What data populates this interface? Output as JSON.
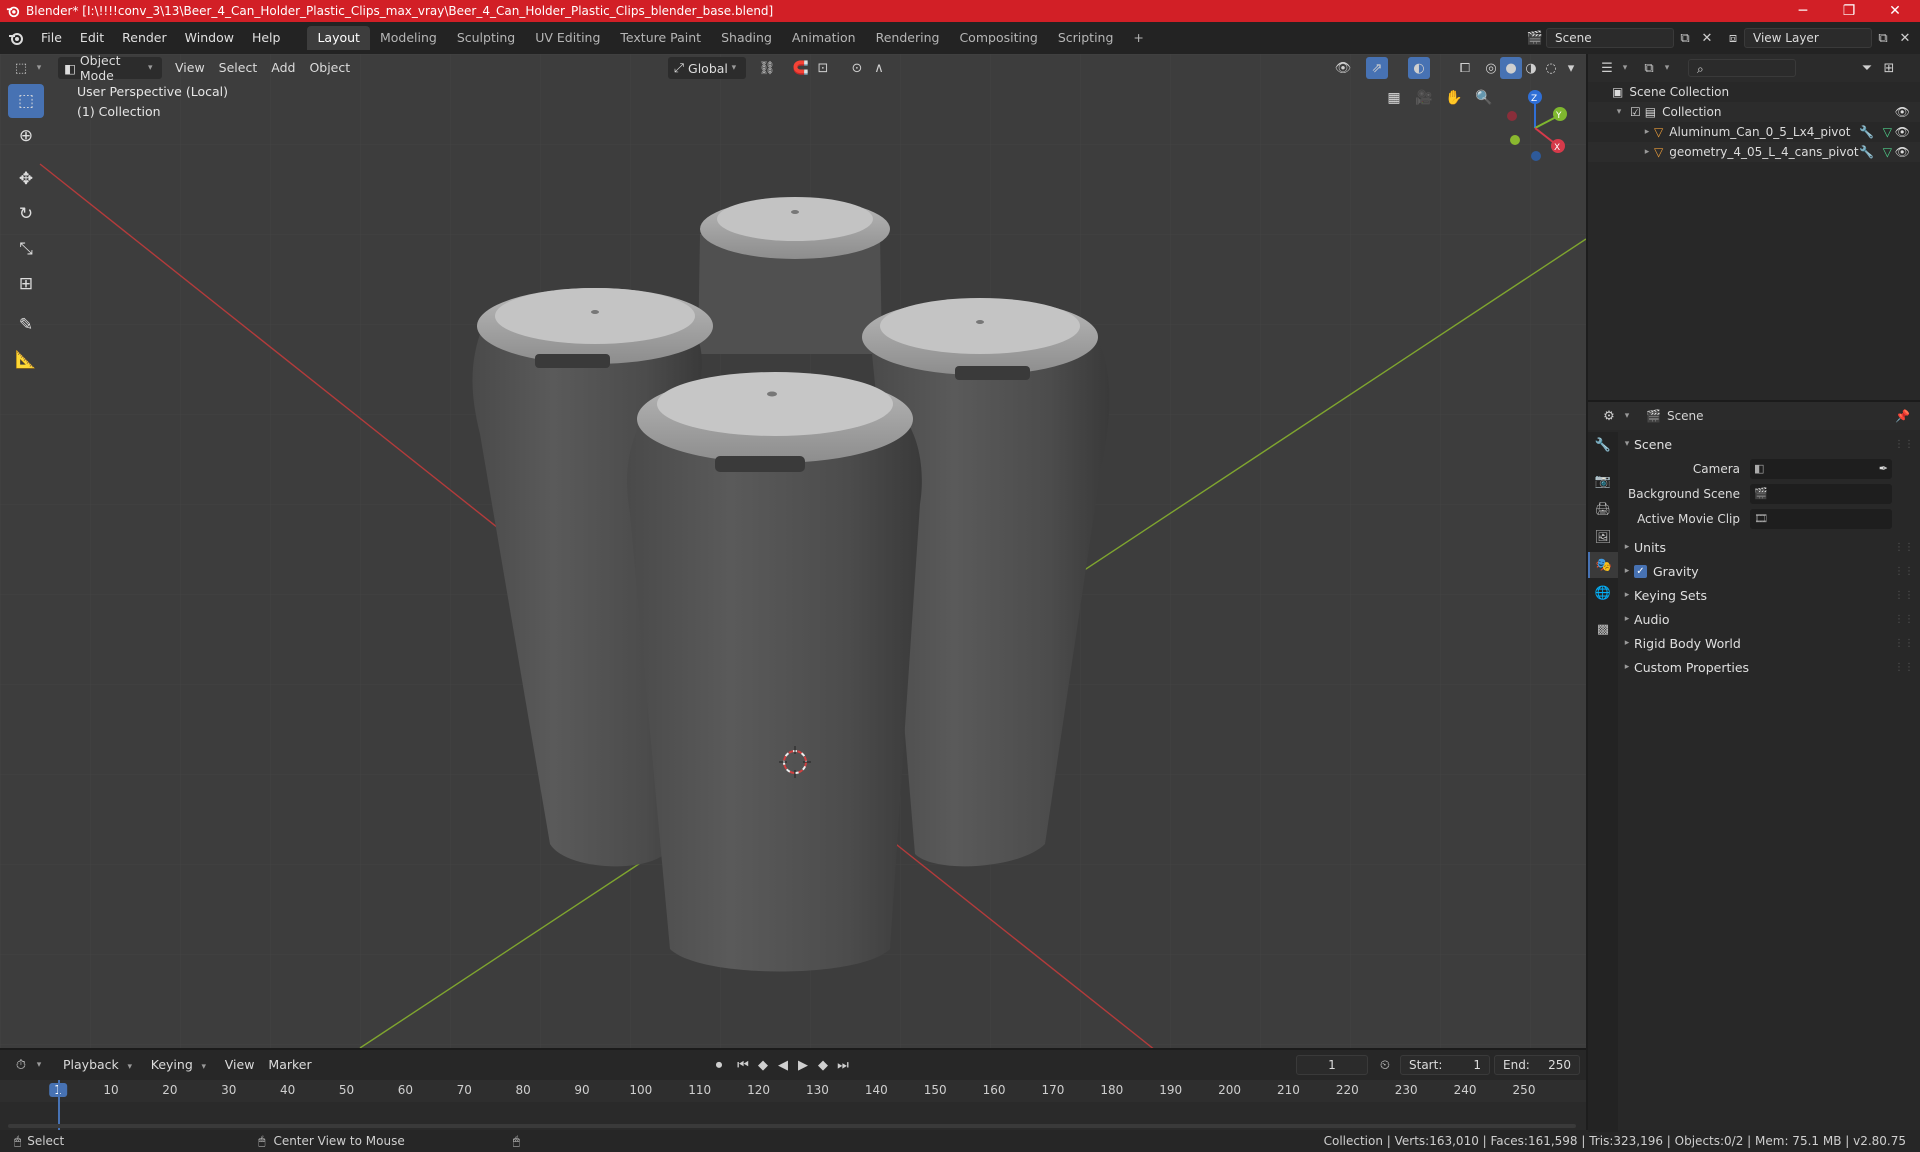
{
  "title_bar": {
    "title": "Blender* [I:\\!!!!conv_3\\13\\Beer_4_Can_Holder_Plastic_Clips_max_vray\\Beer_4_Can_Holder_Plastic_Clips_blender_base.blend]",
    "minimize": "─",
    "maximize": "❐",
    "close": "✕"
  },
  "menu": {
    "items": [
      "File",
      "Edit",
      "Render",
      "Window",
      "Help"
    ],
    "workspaces": [
      "Layout",
      "Modeling",
      "Sculpting",
      "UV Editing",
      "Texture Paint",
      "Shading",
      "Animation",
      "Rendering",
      "Compositing",
      "Scripting"
    ],
    "add_workspace": "+",
    "scene_name": "Scene",
    "view_layer": "View Layer"
  },
  "viewport": {
    "header": {
      "mode": "Object Mode",
      "menus": [
        "View",
        "Select",
        "Add",
        "Object"
      ],
      "orientation": "Global"
    },
    "overlay_text": {
      "perspective": "User Perspective (Local)",
      "collection": "(1) Collection"
    },
    "gizmo": {
      "z": "Z",
      "y": "Y",
      "x": "X"
    }
  },
  "outliner": {
    "scene_collection": "Scene Collection",
    "collection": "Collection",
    "objects": [
      "Aluminum_Can_0_5_Lx4_pivot",
      "geometry_4_05_L_4_cans_pivot"
    ]
  },
  "properties": {
    "context": "Scene",
    "panel_title": "Scene",
    "fields": [
      {
        "label": "Camera"
      },
      {
        "label": "Background Scene"
      },
      {
        "label": "Active Movie Clip"
      }
    ],
    "subpanels": [
      "Units",
      "Gravity",
      "Keying Sets",
      "Audio",
      "Rigid Body World",
      "Custom Properties"
    ],
    "gravity_checked": true
  },
  "timeline": {
    "menus": [
      "Playback",
      "Keying",
      "View",
      "Marker"
    ],
    "current_frame": "1",
    "start_label": "Start:",
    "start": "1",
    "end_label": "End:",
    "end": "250",
    "ticks": [
      "1",
      "10",
      "20",
      "30",
      "40",
      "50",
      "60",
      "70",
      "80",
      "90",
      "100",
      "110",
      "120",
      "130",
      "140",
      "150",
      "160",
      "170",
      "180",
      "190",
      "200",
      "210",
      "220",
      "230",
      "240",
      "250"
    ]
  },
  "status_bar": {
    "select": "Select",
    "center_view": "Center View to Mouse",
    "stats": "Collection | Verts:163,010 | Faces:161,598 | Tris:323,196 | Objects:0/2 | Mem: 75.1 MB | v2.80.75"
  },
  "colors": {
    "title_bar": "#d21f26",
    "accent": "#4772b3",
    "viewport_bg": "#3d3d3d",
    "x_axis": "#b33b3b",
    "y_axis": "#7fa52f"
  }
}
